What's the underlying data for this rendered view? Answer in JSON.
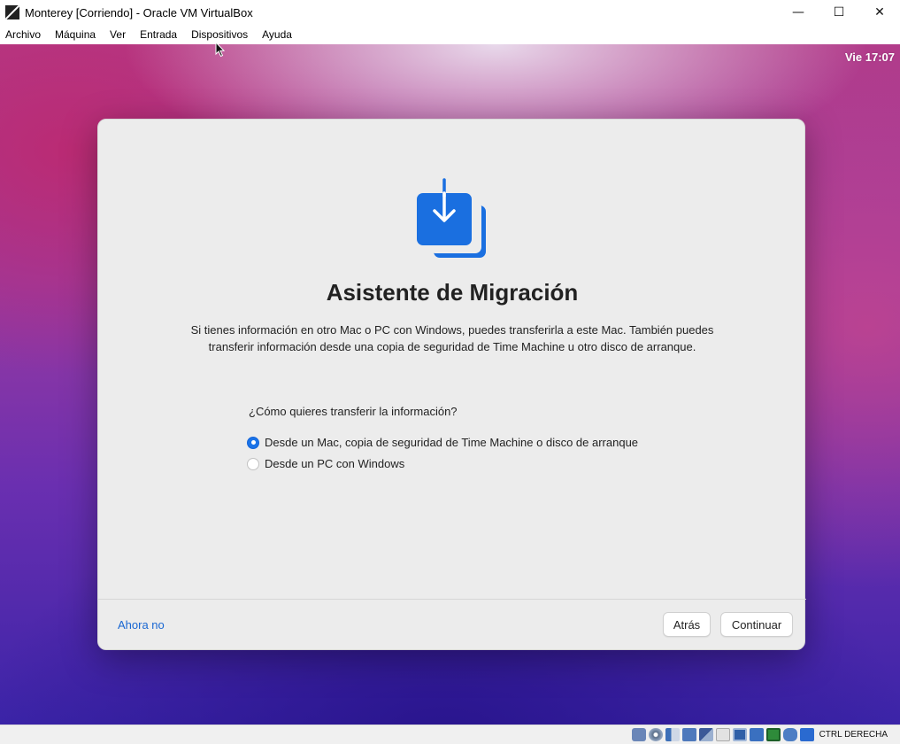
{
  "window": {
    "title": "Monterey [Corriendo] - Oracle VM VirtualBox",
    "minimize_symbol": "—",
    "maximize_symbol": "☐",
    "close_symbol": "✕"
  },
  "menu": {
    "items": [
      "Archivo",
      "Máquina",
      "Ver",
      "Entrada",
      "Dispositivos",
      "Ayuda"
    ]
  },
  "desktop": {
    "clock": "Vie 17:07"
  },
  "dialog": {
    "icon": "migration-download-icon",
    "title": "Asistente de Migración",
    "description": "Si tienes información en otro Mac o PC con Windows, puedes transferirla a este Mac. También puedes transferir información desde una copia de seguridad de Time Machine u otro disco de arranque.",
    "question": "¿Cómo quieres transferir la información?",
    "options": [
      {
        "label": "Desde un Mac, copia de seguridad de Time Machine o disco de arranque",
        "selected": true
      },
      {
        "label": "Desde un PC con Windows",
        "selected": false
      }
    ],
    "later_link": "Ahora no",
    "back_button": "Atrás",
    "continue_button": "Continuar"
  },
  "statusbar": {
    "host_key": "CTRL DERECHA",
    "icons": [
      "hard-disk-icon",
      "optical-disk-icon",
      "audio-icon",
      "network-icon",
      "usb-icon",
      "shared-folder-icon",
      "display-icon",
      "recording-icon",
      "cpu-icon",
      "mouse-integration-icon",
      "keyboard-capture-icon"
    ]
  },
  "colors": {
    "accent": "#1a73e8",
    "link": "#1967d2",
    "dialog_bg": "#ececec",
    "icon_blue": "#1a6fe0"
  }
}
